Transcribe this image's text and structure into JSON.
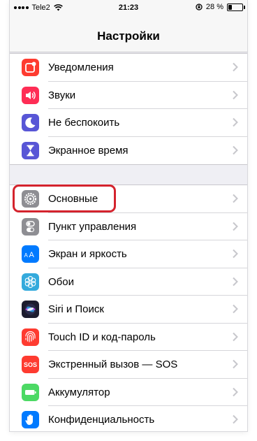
{
  "status_bar": {
    "carrier": "Tele2",
    "time": "21:23",
    "battery": "28 %",
    "battery_level_percent": 28
  },
  "nav": {
    "title": "Настройки"
  },
  "groups": [
    {
      "items": [
        {
          "name": "notifications",
          "label": "Уведомления",
          "icon": "notifications-icon",
          "color": "#fe3b30"
        },
        {
          "name": "sounds",
          "label": "Звуки",
          "icon": "speaker-icon",
          "color": "#fe2d55"
        },
        {
          "name": "do-not-disturb",
          "label": "Не беспокоить",
          "icon": "moon-icon",
          "color": "#5856d6"
        },
        {
          "name": "screen-time",
          "label": "Экранное время",
          "icon": "hourglass-icon",
          "color": "#5856d6"
        }
      ]
    },
    {
      "items": [
        {
          "name": "general",
          "label": "Основные",
          "icon": "gear-icon",
          "color": "#8e8e93",
          "highlighted": true
        },
        {
          "name": "control-center",
          "label": "Пункт управления",
          "icon": "switches-icon",
          "color": "#8e8e93"
        },
        {
          "name": "display",
          "label": "Экран и яркость",
          "icon": "text-size-icon",
          "color": "#007aff"
        },
        {
          "name": "wallpaper",
          "label": "Обои",
          "icon": "flower-icon",
          "color": "#34aadc"
        },
        {
          "name": "siri",
          "label": "Siri и Поиск",
          "icon": "siri-icon",
          "color": "#1c1c2e"
        },
        {
          "name": "touch-id",
          "label": "Touch ID и код-пароль",
          "icon": "fingerprint-icon",
          "color": "#fe3b30"
        },
        {
          "name": "sos",
          "label": "Экстренный вызов — SOS",
          "icon": "sos-icon",
          "color": "#fe3b30",
          "icon_text": "SOS"
        },
        {
          "name": "battery",
          "label": "Аккумулятор",
          "icon": "battery-icon",
          "color": "#4cd964"
        },
        {
          "name": "privacy",
          "label": "Конфиденциальность",
          "icon": "hand-icon",
          "color": "#007aff"
        }
      ]
    }
  ],
  "colors": {
    "highlight": "#d4232d",
    "background": "#efeff4",
    "chevron": "#c7c7cc"
  }
}
